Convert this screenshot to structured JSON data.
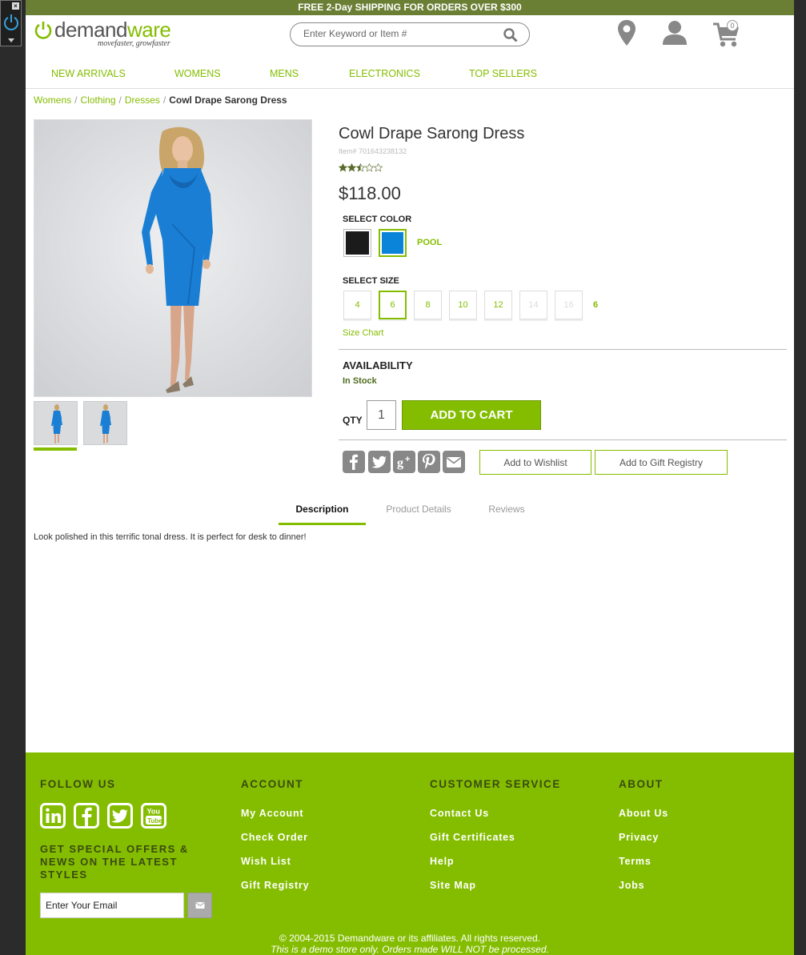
{
  "promo": {
    "bold": "FREE 2-Day SHIPPING",
    "rest": " FOR ORDERS OVER $300"
  },
  "header": {
    "logo_demand": "demand",
    "logo_ware": "ware",
    "tagline": "movefaster, growfaster",
    "search_placeholder": "Enter Keyword or Item #",
    "cart_count": "0"
  },
  "nav": [
    "NEW ARRIVALS",
    "WOMENS",
    "MENS",
    "ELECTRONICS",
    "TOP SELLERS"
  ],
  "breadcrumb": [
    "Womens",
    "Clothing",
    "Dresses",
    "Cowl Drape Sarong Dress"
  ],
  "product": {
    "title": "Cowl Drape Sarong Dress",
    "item_no": "Item# 701643238132",
    "rating": 2.5,
    "price": "$118.00",
    "select_color_label": "SELECT COLOR",
    "colors": [
      {
        "name": "black",
        "hex": "#1b1b1b"
      },
      {
        "name": "pool",
        "hex": "#0a84d8"
      }
    ],
    "selected_color": "POOL",
    "select_size_label": "SELECT SIZE",
    "sizes": [
      "4",
      "6",
      "8",
      "10",
      "12",
      "14",
      "16"
    ],
    "selected_size": "6",
    "size_chart": "Size Chart",
    "availability_label": "AVAILABILITY",
    "availability": "In Stock",
    "qty_label": "QTY",
    "qty": "1",
    "add_to_cart": "ADD TO CART",
    "wishlist": "Add to Wishlist",
    "gift_registry": "Add to Gift Registry"
  },
  "tabs": [
    "Description",
    "Product Details",
    "Reviews"
  ],
  "description": "Look polished in this terrific tonal dress. It is perfect for desk to dinner!",
  "footer": {
    "follow_us": "FOLLOW US",
    "offers": "GET SPECIAL OFFERS & NEWS ON THE LATEST STYLES",
    "email_placeholder": "Enter Your Email",
    "account_heading": "ACCOUNT",
    "account_links": [
      "My Account",
      "Check Order",
      "Wish List",
      "Gift Registry"
    ],
    "service_heading": "CUSTOMER SERVICE",
    "service_links": [
      "Contact Us",
      "Gift Certificates",
      "Help",
      "Site Map"
    ],
    "about_heading": "ABOUT",
    "about_links": [
      "About Us",
      "Privacy",
      "Terms",
      "Jobs"
    ],
    "copyright": "© 2004-2015 Demandware or its affiliates. All rights reserved.",
    "demo_notice": "This is a demo store only. Orders made WILL NOT be processed."
  },
  "colors": {
    "accent": "#84bd00",
    "promo_bar": "#6b7f34",
    "dress": "#1a7fd4"
  }
}
